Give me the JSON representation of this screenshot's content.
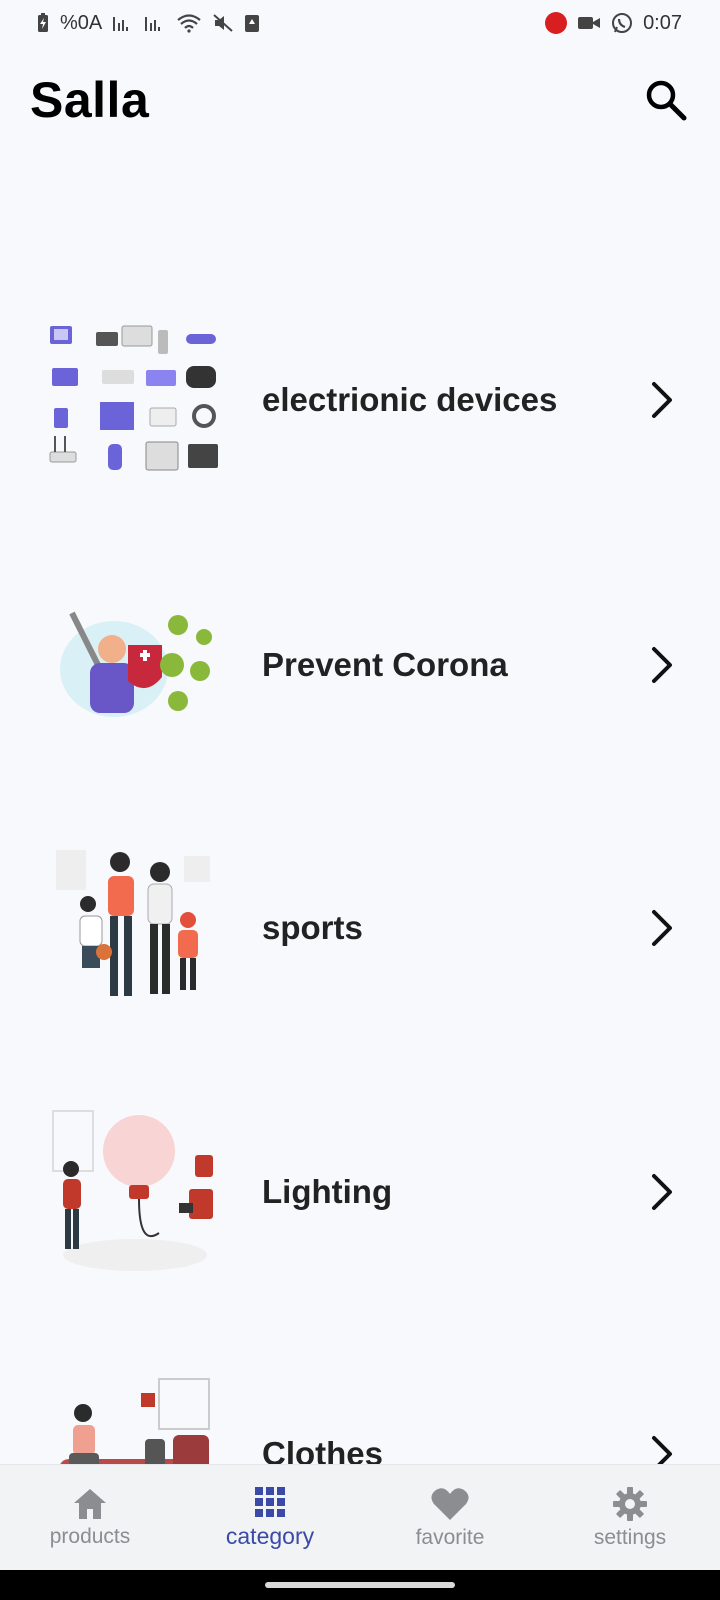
{
  "status_bar": {
    "battery": "%0A",
    "time": "0:07",
    "left_icons": [
      "battery-charging-icon",
      "signal-icon",
      "signal-icon",
      "wifi-icon",
      "mute-icon",
      "recycle-icon"
    ],
    "right_icons": [
      "record-icon",
      "video-call-icon",
      "whatsapp-icon"
    ]
  },
  "app_bar": {
    "title": "Salla",
    "search_icon": "search-icon"
  },
  "categories": [
    {
      "label": "electrionic devices",
      "image": "electronics-illustration",
      "chevron": "chevron-right-icon"
    },
    {
      "label": "Prevent Corona",
      "image": "prevent-corona-illustration",
      "chevron": "chevron-right-icon"
    },
    {
      "label": "sports",
      "image": "sports-family-illustration",
      "chevron": "chevron-right-icon"
    },
    {
      "label": "Lighting",
      "image": "lighting-bulb-illustration",
      "chevron": "chevron-right-icon"
    },
    {
      "label": "Clothes",
      "image": "clothes-illustration",
      "chevron": "chevron-right-icon"
    }
  ],
  "bottom_nav": {
    "items": [
      {
        "label": "products",
        "icon": "home-icon",
        "active": false
      },
      {
        "label": "category",
        "icon": "grid-icon",
        "active": true
      },
      {
        "label": "favorite",
        "icon": "heart-icon",
        "active": false
      },
      {
        "label": "settings",
        "icon": "gear-icon",
        "active": false
      }
    ],
    "active_color": "#3b49a8",
    "inactive_color": "#8b8d91"
  }
}
